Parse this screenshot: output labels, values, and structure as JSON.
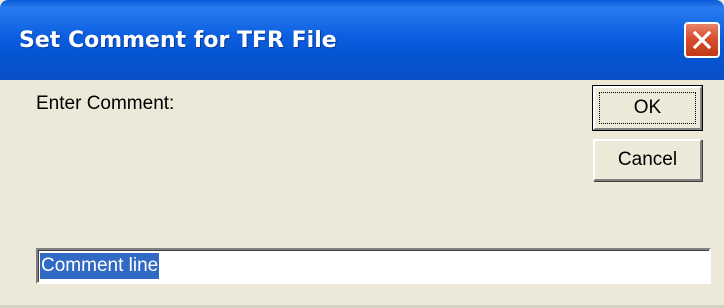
{
  "window": {
    "title": "Set Comment for TFR File",
    "close_icon": "close-icon",
    "colors": {
      "titlebar": "#0b5fe0",
      "close_button": "#d4502e",
      "body": "#ece9d8",
      "selection": "#316ac5"
    }
  },
  "dialog": {
    "prompt_label": "Enter Comment:",
    "ok_label": "OK",
    "cancel_label": "Cancel",
    "comment_value": "Comment line"
  }
}
